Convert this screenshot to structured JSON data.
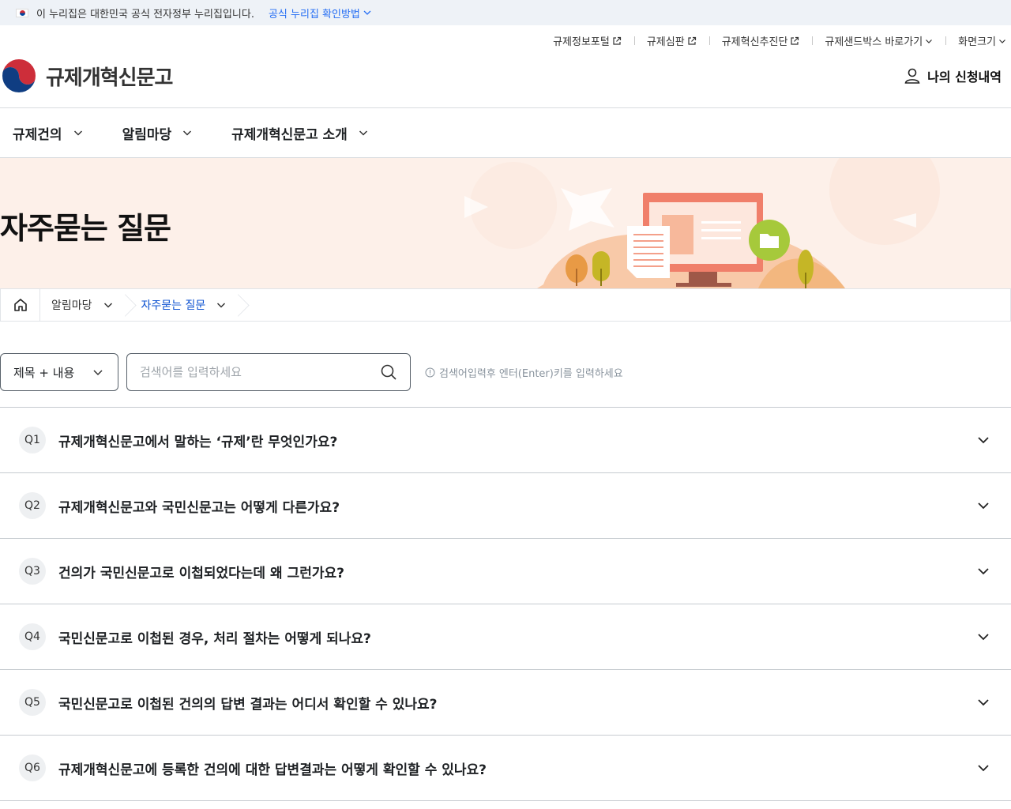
{
  "gov_banner": {
    "text": "이 누리집은 대한민국 공식 전자정부 누리집입니다.",
    "verify_link": "공식 누리집 확인방법"
  },
  "header": {
    "util_links": [
      {
        "label": "규제정보포털",
        "icon": "external-link-icon"
      },
      {
        "label": "규제심판",
        "icon": "external-link-icon"
      },
      {
        "label": "규제혁신추진단",
        "icon": "external-link-icon"
      },
      {
        "label": "규제샌드박스 바로가기",
        "icon": "chevron-down-icon"
      },
      {
        "label": "화면크기",
        "icon": "chevron-down-icon"
      }
    ],
    "logo_text": "규제개혁신문고",
    "my_apply": "나의 신청내역"
  },
  "gnb": {
    "menus": [
      "규제건의",
      "알림마당",
      "규제개혁신문고 소개"
    ]
  },
  "hero": {
    "title": "자주묻는 질문"
  },
  "breadcrumb": {
    "items": [
      "알림마당",
      "자주묻는 질문"
    ]
  },
  "search": {
    "select_value": "제목 + 내용",
    "placeholder": "검색어를 입력하세요",
    "hint": "검색어입력후 엔터(Enter)키를 입력하세요"
  },
  "faq": [
    {
      "no": "Q1",
      "question": "규제개혁신문고에서 말하는 ‘규제’란 무엇인가요?"
    },
    {
      "no": "Q2",
      "question": "규제개혁신문고와 국민신문고는 어떻게 다른가요?"
    },
    {
      "no": "Q3",
      "question": "건의가 국민신문고로 이첩되었다는데 왜 그런가요?"
    },
    {
      "no": "Q4",
      "question": "국민신문고로 이첩된 경우, 처리 절차는 어떻게 되나요?"
    },
    {
      "no": "Q5",
      "question": "국민신문고로 이첩된 건의의 답변 결과는 어디서 확인할 수 있나요?"
    },
    {
      "no": "Q6",
      "question": "규제개혁신문고에 등록한 건의에 대한 답변결과는 어떻게 확인할 수 있나요?"
    }
  ],
  "colors": {
    "accent": "#256ef4",
    "breadcrumb_active": "#0b50d0",
    "hero_bg": "#fdf0e9"
  }
}
